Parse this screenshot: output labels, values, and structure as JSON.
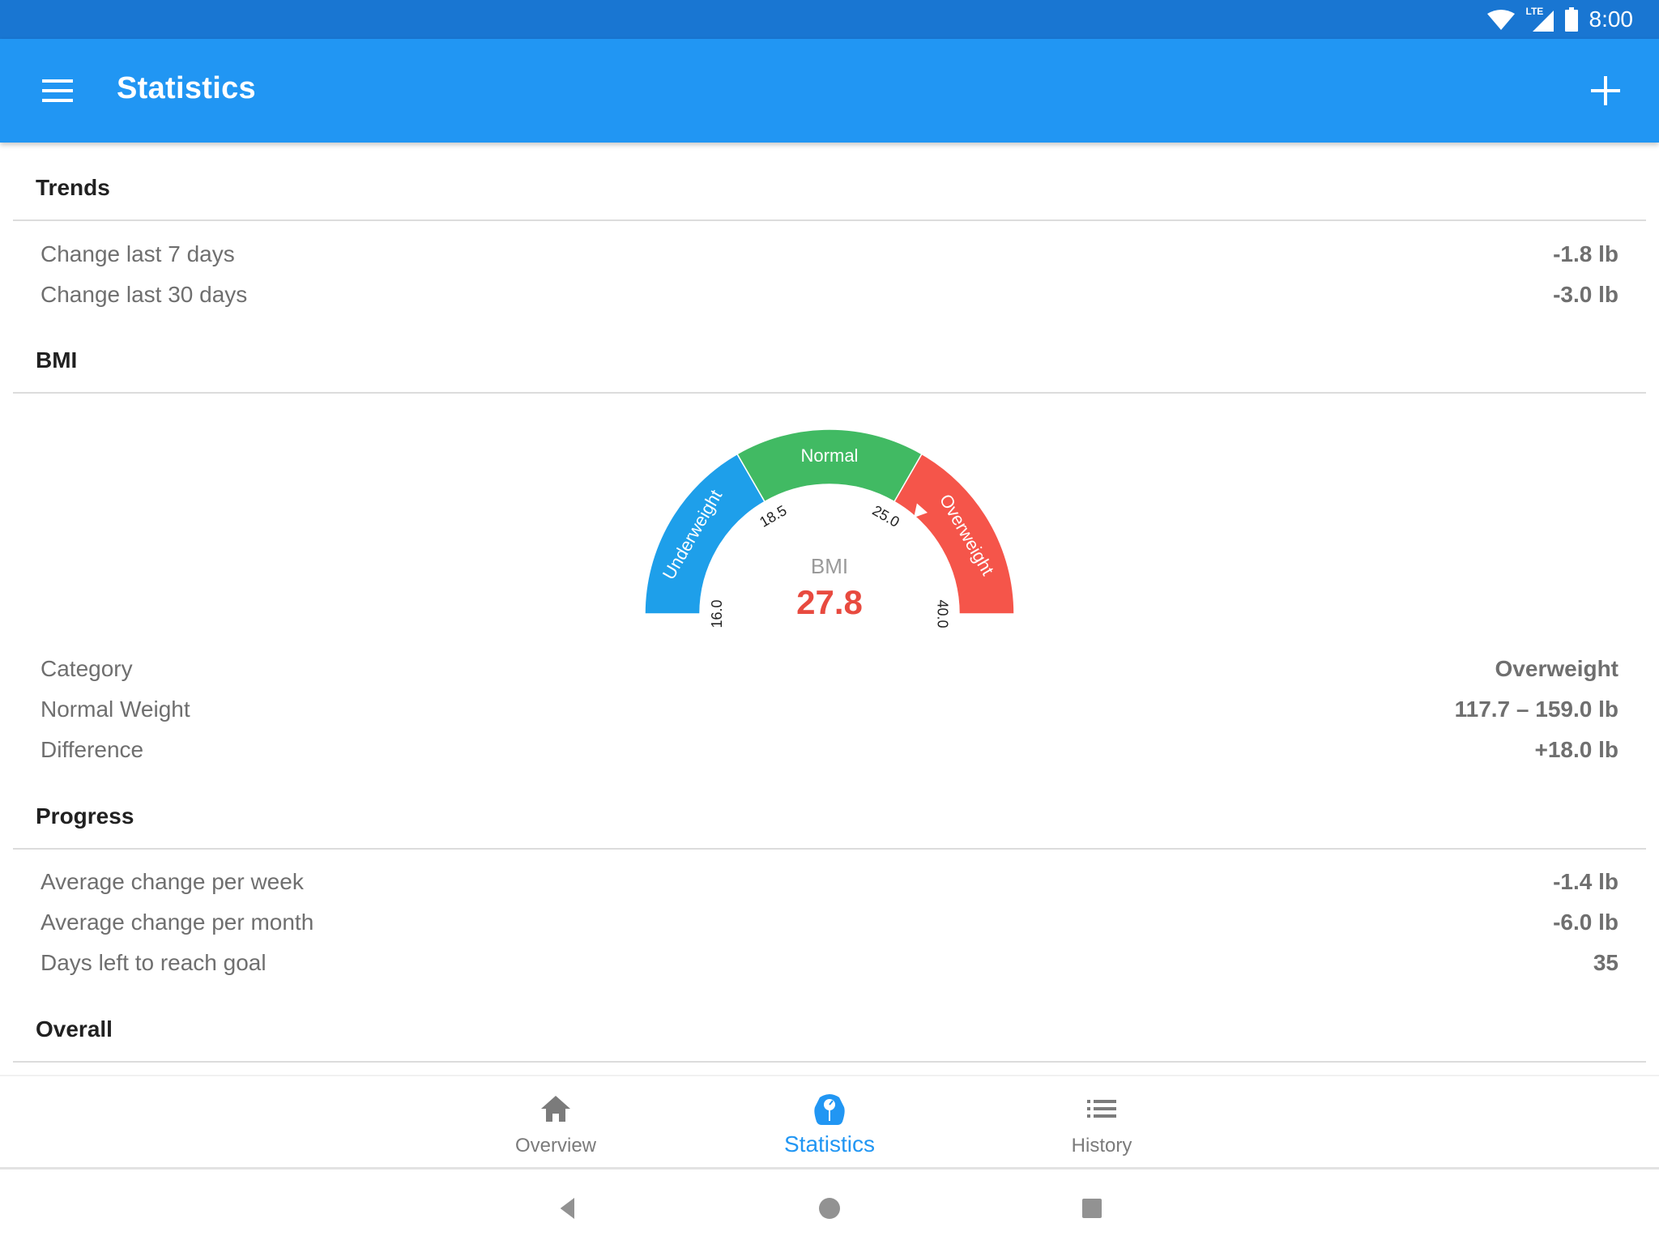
{
  "status_bar": {
    "time": "8:00",
    "network_label": "LTE",
    "icons": [
      "wifi-icon",
      "lte-signal-icon",
      "battery-icon"
    ]
  },
  "app_bar": {
    "title": "Statistics",
    "menu_icon": "hamburger-menu-icon",
    "action_icon": "add-icon"
  },
  "sections": {
    "trends": {
      "title": "Trends",
      "rows": [
        {
          "label": "Change last 7 days",
          "value": "-1.8 lb"
        },
        {
          "label": "Change last 30 days",
          "value": "-3.0 lb"
        }
      ]
    },
    "bmi": {
      "title": "BMI",
      "gauge": {
        "center_label": "BMI",
        "value": "27.8",
        "value_numeric": 27.8,
        "value_color": "#E84A3F",
        "segments": [
          {
            "label": "Underweight",
            "from": 16.0,
            "to": 18.5,
            "color": "#1E9FEA"
          },
          {
            "label": "Normal",
            "from": 18.5,
            "to": 25.0,
            "color": "#41BA63"
          },
          {
            "label": "Overweight",
            "from": 25.0,
            "to": 40.0,
            "color": "#F5554A"
          }
        ],
        "ticks": [
          "16.0",
          "18.5",
          "25.0",
          "40.0"
        ]
      },
      "rows": [
        {
          "label": "Category",
          "value": "Overweight"
        },
        {
          "label": "Normal Weight",
          "value": "117.7 – 159.0 lb"
        },
        {
          "label": "Difference",
          "value": "+18.0 lb"
        }
      ]
    },
    "progress": {
      "title": "Progress",
      "rows": [
        {
          "label": "Average change per week",
          "value": "-1.4 lb"
        },
        {
          "label": "Average change per month",
          "value": "-6.0 lb"
        },
        {
          "label": "Days left to reach goal",
          "value": "35"
        }
      ]
    },
    "overall": {
      "title": "Overall"
    }
  },
  "bottom_nav": {
    "items": [
      {
        "label": "Overview",
        "icon": "home-icon",
        "active": false
      },
      {
        "label": "Statistics",
        "icon": "scale-icon",
        "active": true
      },
      {
        "label": "History",
        "icon": "list-icon",
        "active": false
      }
    ],
    "active_color": "#2196F3",
    "inactive_color": "#7B7B7B"
  },
  "system_nav": {
    "buttons": [
      "back-icon",
      "home-circle-icon",
      "recents-icon"
    ]
  },
  "colors": {
    "status_bar": "#1976D2",
    "app_bar": "#2196F3"
  }
}
